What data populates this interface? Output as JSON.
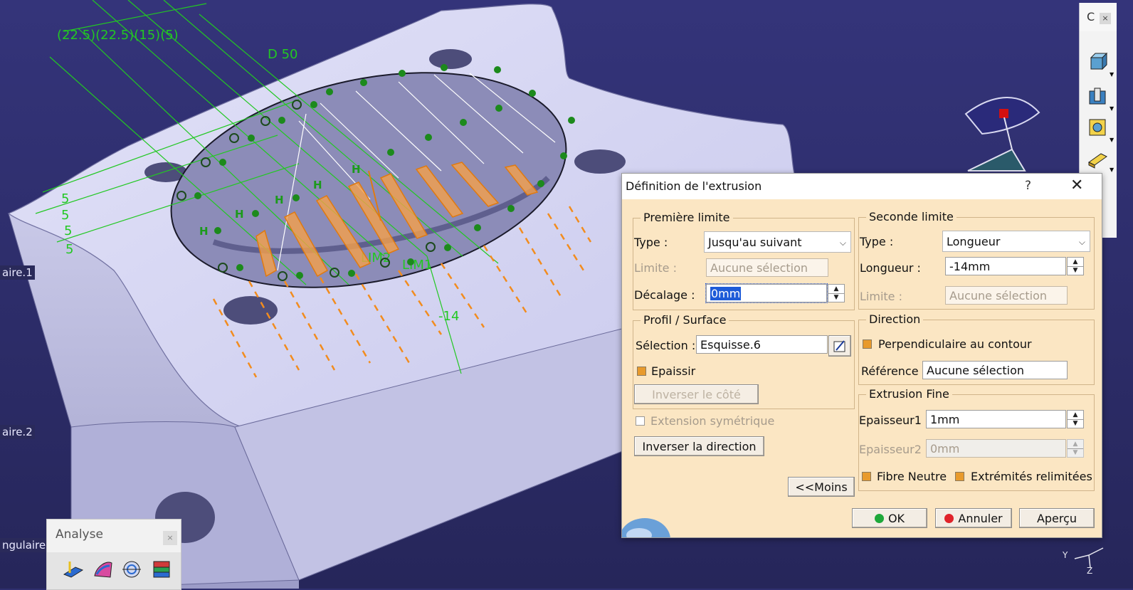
{
  "tree_labels": [
    "aire.1",
    "aire.2",
    "ngulaire."
  ],
  "viewport_annotations": {
    "dims": [
      "(22.5)",
      "(22.5)",
      "(15)",
      "(5)",
      "5",
      "D 50",
      "5",
      "5",
      "5",
      "5",
      "-14",
      "LIM2",
      "LIM1"
    ],
    "constraint_letter": "H"
  },
  "right_toolbar": {
    "header": "C",
    "close": "×"
  },
  "analyse_toolbar": {
    "title": "Analyse",
    "close": "×"
  },
  "dialog": {
    "title": "Définition de l'extrusion",
    "help": "?",
    "close": "✕",
    "first_limit": {
      "group": "Première limite",
      "type_label": "Type :",
      "type_value": "Jusqu'au suivant",
      "limit_label": "Limite :",
      "limit_value": "Aucune sélection",
      "offset_label": "Décalage :",
      "offset_value": "0mm"
    },
    "profile": {
      "group": "Profil / Surface",
      "selection_label": "Sélection :",
      "selection_value": "Esquisse.6",
      "thicken_label": "Epaissir",
      "reverse_side": "Inverser le côté"
    },
    "symmetric_label": "Extension symétrique",
    "reverse_direction": "Inverser la direction",
    "less_button": "<<Moins",
    "second_limit": {
      "group": "Seconde limite",
      "type_label": "Type :",
      "type_value": "Longueur",
      "length_label": "Longueur :",
      "length_value": "-14mm",
      "limit_label": "Limite :",
      "limit_value": "Aucune sélection"
    },
    "direction": {
      "group": "Direction",
      "perpendicular_label": "Perpendiculaire au contour",
      "reference_label": "Référence :",
      "reference_value": "Aucune sélection"
    },
    "thin": {
      "group": "Extrusion Fine",
      "thickness1_label": "Epaisseur1 :",
      "thickness1_value": "1mm",
      "thickness2_label": "Epaisseur2 :",
      "thickness2_value": "0mm",
      "neutral_fiber": "Fibre Neutre",
      "trimmed_ends": "Extrémités relimitées"
    },
    "ok": "OK",
    "cancel": "Annuler",
    "preview": "Aperçu"
  },
  "colors": {
    "background": "#2f2f6e",
    "part_face": "#d4d4f0",
    "sketch_green": "#22c822",
    "preview_orange": "#f28c1e",
    "dialog_bg": "#fbe6c3"
  }
}
